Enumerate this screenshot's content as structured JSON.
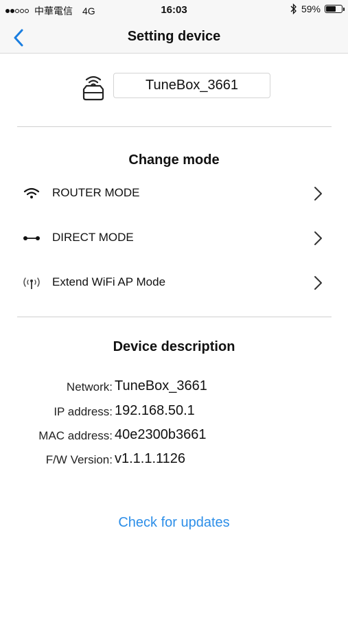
{
  "status_bar": {
    "carrier": "中華電信",
    "network": "4G",
    "time": "16:03",
    "battery_percent": "59%",
    "battery_level": 0.59
  },
  "nav": {
    "title": "Setting device",
    "accent_color": "#1a7ee0"
  },
  "device": {
    "name": "TuneBox_3661"
  },
  "change_mode": {
    "title": "Change mode",
    "items": [
      {
        "label": "ROUTER MODE",
        "icon": "wifi-icon"
      },
      {
        "label": "DIRECT MODE",
        "icon": "direct-link-icon"
      },
      {
        "label": "Extend WiFi AP Mode",
        "icon": "antenna-broadcast-icon"
      }
    ]
  },
  "device_description": {
    "title": "Device description",
    "rows": [
      {
        "label": "Network:",
        "value": "TuneBox_3661"
      },
      {
        "label": "IP address:",
        "value": "192.168.50.1"
      },
      {
        "label": "MAC address:",
        "value": "40e2300b3661"
      },
      {
        "label": "F/W Version:",
        "value": "v1.1.1.1126"
      }
    ]
  },
  "update": {
    "label": "Check for updates",
    "color": "#2c8ee8"
  }
}
